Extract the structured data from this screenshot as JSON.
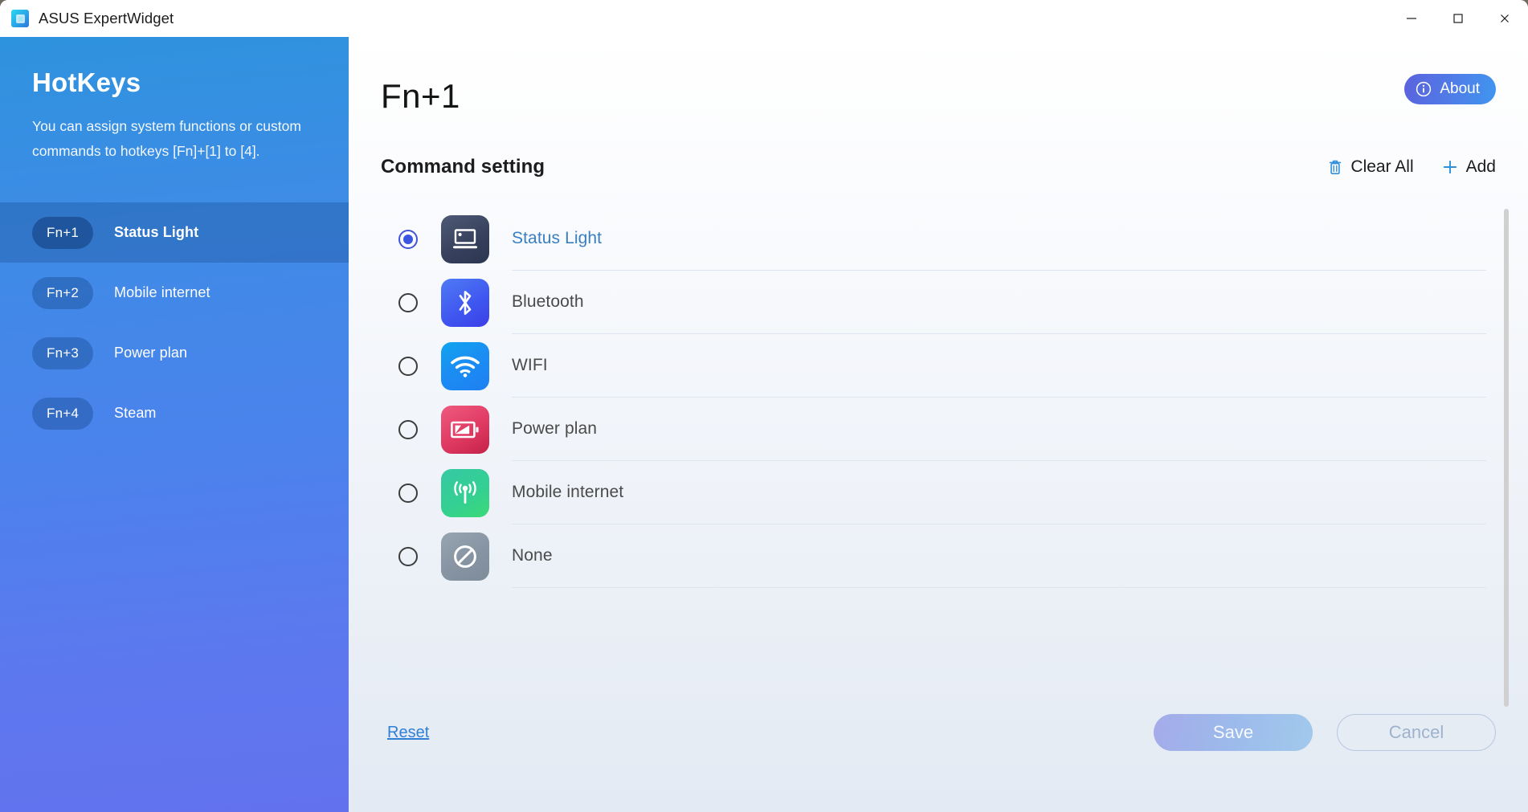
{
  "window": {
    "title": "ASUS ExpertWidget",
    "app_icon": "asus-expertwidget-icon",
    "controls": {
      "minimize": "Minimize",
      "maximize": "Maximize",
      "close": "Close"
    }
  },
  "sidebar": {
    "title": "HotKeys",
    "description": "You can assign system functions or custom commands to hotkeys [Fn]+[1] to [4].",
    "items": [
      {
        "key": "Fn+1",
        "label": "Status Light",
        "active": true
      },
      {
        "key": "Fn+2",
        "label": "Mobile internet",
        "active": false
      },
      {
        "key": "Fn+3",
        "label": "Power plan",
        "active": false
      },
      {
        "key": "Fn+4",
        "label": "Steam",
        "active": false
      }
    ]
  },
  "main": {
    "page_title": "Fn+1",
    "about_label": "About",
    "section_title": "Command setting",
    "clear_all_label": "Clear All",
    "add_label": "Add",
    "options": [
      {
        "label": "Status Light",
        "icon": "laptop-status-light-icon",
        "selected": true
      },
      {
        "label": "Bluetooth",
        "icon": "bluetooth-icon",
        "selected": false
      },
      {
        "label": "WIFI",
        "icon": "wifi-icon",
        "selected": false
      },
      {
        "label": "Power plan",
        "icon": "battery-icon",
        "selected": false
      },
      {
        "label": "Mobile internet",
        "icon": "cellular-tower-icon",
        "selected": false
      },
      {
        "label": "None",
        "icon": "no-entry-icon",
        "selected": false
      }
    ]
  },
  "footer": {
    "reset_label": "Reset",
    "save_label": "Save",
    "cancel_label": "Cancel"
  },
  "colors": {
    "accent_blue": "#2f7fd6",
    "sidebar_top": "#2e93de",
    "sidebar_bottom": "#6272ee",
    "about_gradient_start": "#5b62dd",
    "about_gradient_end": "#3f96f0",
    "selected_label": "#3a7fc1",
    "radio_selected": "#3a55e0"
  }
}
